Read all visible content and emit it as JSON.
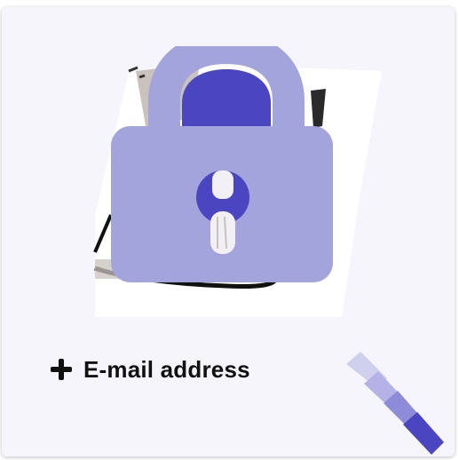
{
  "card": {
    "add_label": "E-mail address"
  },
  "icons": {
    "lock": "lock-icon",
    "plus": "plus-icon",
    "chevrons": "chevron-down-icon"
  },
  "colors": {
    "card_bg": "#f5f5fb",
    "lock_body": "#a4a4dc",
    "lock_accent": "#4a45c0",
    "chevron_light": "#cfcfee",
    "chevron_mid": "#8e8bd8",
    "chevron_dark": "#4a45c0"
  }
}
